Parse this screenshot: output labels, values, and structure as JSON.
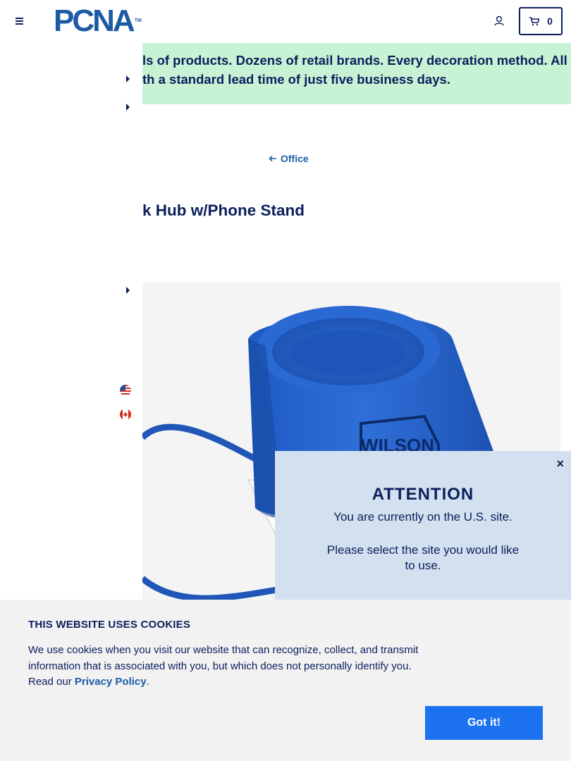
{
  "header": {
    "logo_text": "PCNA",
    "logo_tm": "TM",
    "cart_count": "0"
  },
  "banner": {
    "line1": "ls of products. Dozens of retail brands. Every decoration method. All",
    "line2": "th a standard lead time of just five business days."
  },
  "breadcrumb": {
    "back_label": "Office"
  },
  "product": {
    "title": "k Hub w/Phone Stand",
    "imprint_text": "WILSON"
  },
  "attention_modal": {
    "close_label": "×",
    "title": "ATTENTION",
    "current_site_text": "You are currently on the U.S. site.",
    "select_text": "Please select the site you would like to use."
  },
  "cookie_banner": {
    "title": "THIS WEBSITE USES COOKIES",
    "text_before_link": "We use cookies when you visit our website that can recognize, collect, and transmit information that is associated with you, but which does not personally identify you. Read our ",
    "link_label": "Privacy Policy",
    "text_after_link": ".",
    "accept_label": "Got it!"
  },
  "colors": {
    "navy": "#0b1f5c",
    "brand_blue": "#1c5ba4",
    "banner_green": "#c8f2d4",
    "modal_bg": "#d3e0ef",
    "accept_button": "#1d72f2"
  },
  "icons": [
    "hamburger-menu-icon",
    "account-icon",
    "cart-icon",
    "arrow-left-icon",
    "caret-right-icon",
    "us-flag-icon",
    "canada-flag-icon",
    "close-icon"
  ]
}
